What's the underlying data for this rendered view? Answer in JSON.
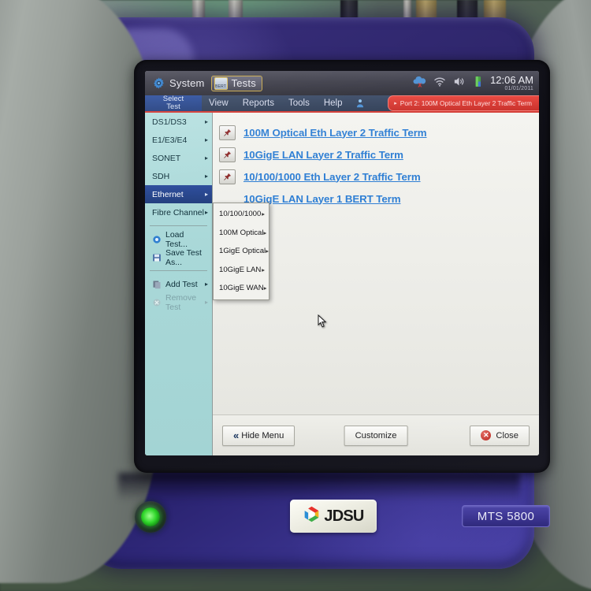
{
  "device": {
    "brand": "JDSU",
    "model": "MTS 5800",
    "power_button": "power-button"
  },
  "titlebar": {
    "system_label": "System",
    "tests_label": "Tests",
    "tests_icon_text": "BERT",
    "icons": [
      "cloud-upload-error-icon",
      "wifi-icon",
      "speaker-icon",
      "battery-icon"
    ],
    "clock_time": "12:06 AM",
    "clock_date": "01/01/2011"
  },
  "menubar": {
    "select_test_line1": "Select",
    "select_test_line2": "Test",
    "entries": [
      "View",
      "Reports",
      "Tools",
      "Help"
    ],
    "help_icon": "help-person-icon",
    "port_status": "Port 2: 100M Optical Eth Layer 2 Traffic Term",
    "port_status_arrow": "▸"
  },
  "sidebar": {
    "items": [
      {
        "label": "DS1/DS3",
        "caret": "▸",
        "state": "normal",
        "icon": ""
      },
      {
        "label": "E1/E3/E4",
        "caret": "▸",
        "state": "normal",
        "icon": ""
      },
      {
        "label": "SONET",
        "caret": "▸",
        "state": "normal",
        "icon": ""
      },
      {
        "label": "SDH",
        "caret": "▸",
        "state": "normal",
        "icon": ""
      },
      {
        "label": "Ethernet",
        "caret": "▸",
        "state": "active",
        "icon": ""
      },
      {
        "label": "Fibre Channel",
        "caret": "▸",
        "state": "normal",
        "icon": ""
      },
      {
        "label": "Load Test...",
        "caret": "",
        "state": "normal",
        "icon": "load-test-icon"
      },
      {
        "label": "Save Test As...",
        "caret": "",
        "state": "normal",
        "icon": "save-test-icon"
      },
      {
        "label": "Add Test",
        "caret": "▸",
        "state": "normal",
        "icon": "add-test-icon"
      },
      {
        "label": "Remove Test",
        "caret": "▸",
        "state": "disabled",
        "icon": "remove-test-icon"
      }
    ]
  },
  "submenu": {
    "items": [
      {
        "label": "10/100/1000",
        "caret": "▸"
      },
      {
        "label": "100M Optical",
        "caret": "▸"
      },
      {
        "label": "1GigE Optical",
        "caret": "▸"
      },
      {
        "label": "10GigE LAN",
        "caret": "▸"
      },
      {
        "label": "10GigE WAN",
        "caret": "▸"
      }
    ]
  },
  "content": {
    "links": [
      {
        "label": "100M Optical Eth Layer 2 Traffic Term",
        "icon": "pin-icon"
      },
      {
        "label": "10GigE LAN Layer 2 Traffic Term",
        "icon": "pin-icon"
      },
      {
        "label": "10/100/1000 Eth Layer 2 Traffic Term",
        "icon": "pin-icon"
      },
      {
        "label": "10GigE LAN Layer 1 BERT Term",
        "icon": "pin-icon"
      }
    ]
  },
  "footer": {
    "hide_menu": "Hide Menu",
    "hide_menu_icon": "double-chevron-left-icon",
    "customize": "Customize",
    "close": "Close",
    "close_icon": "close-x-circle-icon"
  },
  "colors": {
    "accent_blue": "#2f7fd4",
    "sidebar_cyan": "#a9d8d8",
    "highlight_blue": "#2f4f9e",
    "status_red": "#d33a33",
    "device_purple": "#2c2468"
  }
}
